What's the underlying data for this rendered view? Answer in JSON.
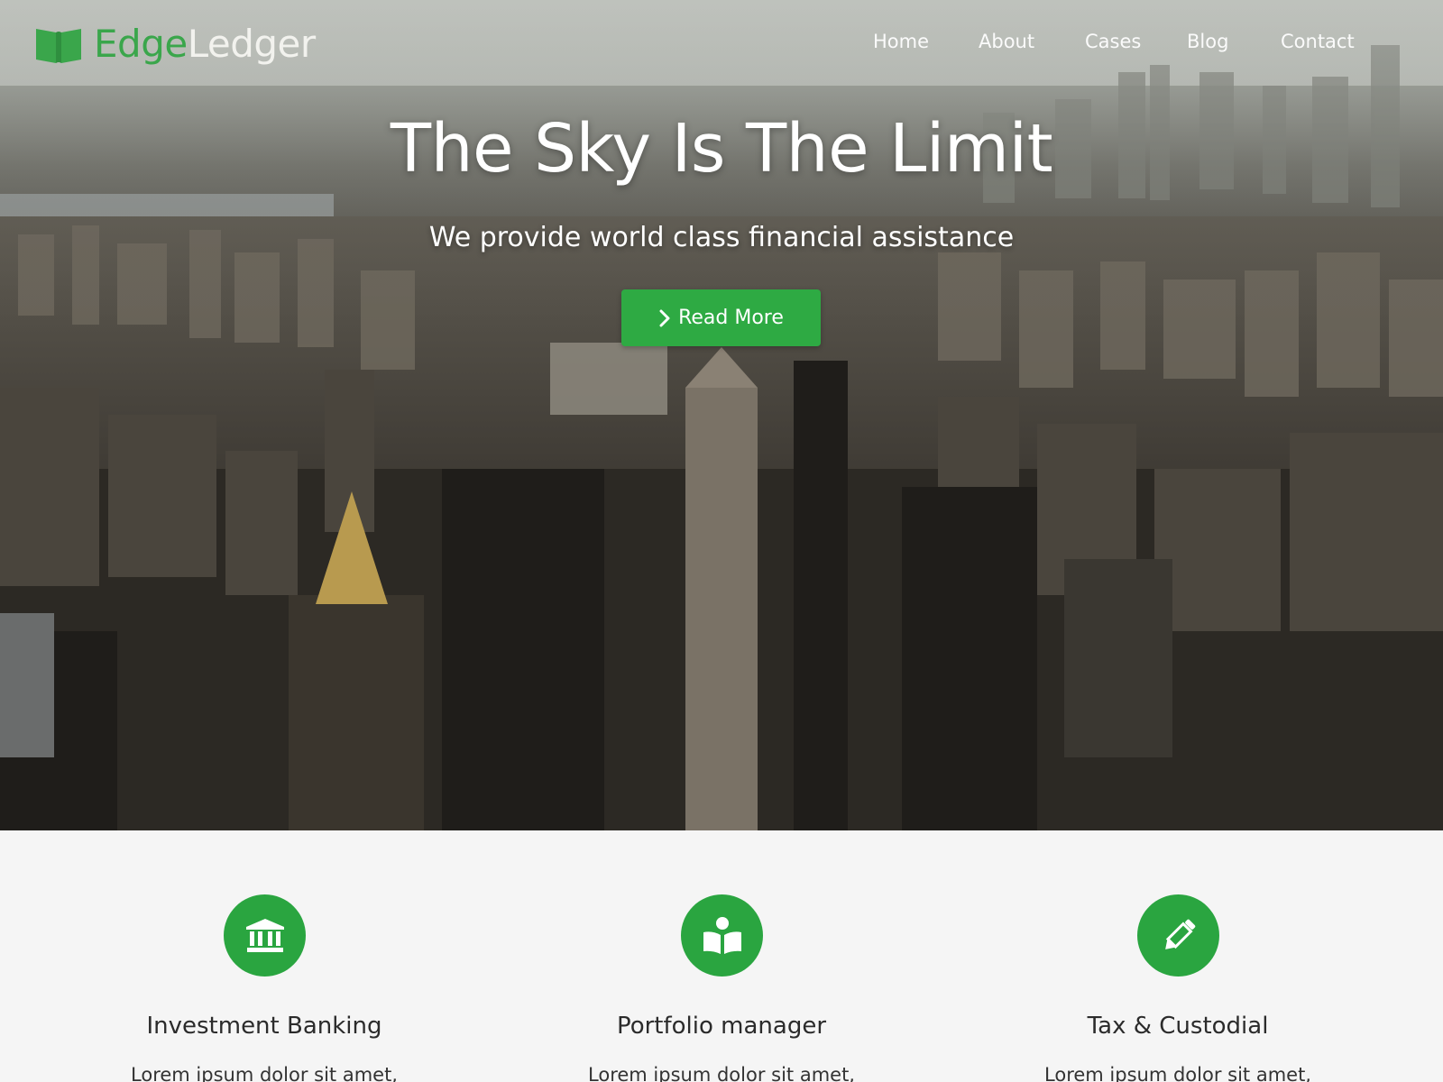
{
  "brand": {
    "part1": "Edge",
    "part2": "Ledger",
    "icon": "book-open-icon",
    "color": "#3aa64b"
  },
  "nav": {
    "items": [
      {
        "label": "Home"
      },
      {
        "label": "About"
      },
      {
        "label": "Cases"
      },
      {
        "label": "Blog"
      },
      {
        "label": "Contact"
      }
    ]
  },
  "hero": {
    "title": "The Sky Is The Limit",
    "subtitle": "We provide world class financial assistance",
    "cta_label": "Read More",
    "cta_icon": "chevron-right-icon",
    "cta_color": "#2eaa43"
  },
  "services": {
    "accent": "#2aa540",
    "items": [
      {
        "icon": "bank-icon",
        "title": "Investment Banking",
        "text": "Lorem ipsum dolor sit amet,"
      },
      {
        "icon": "reader-icon",
        "title": "Portfolio manager",
        "text": "Lorem ipsum dolor sit amet,"
      },
      {
        "icon": "pencil-icon",
        "title": "Tax & Custodial",
        "text": "Lorem ipsum dolor sit amet,"
      }
    ]
  }
}
